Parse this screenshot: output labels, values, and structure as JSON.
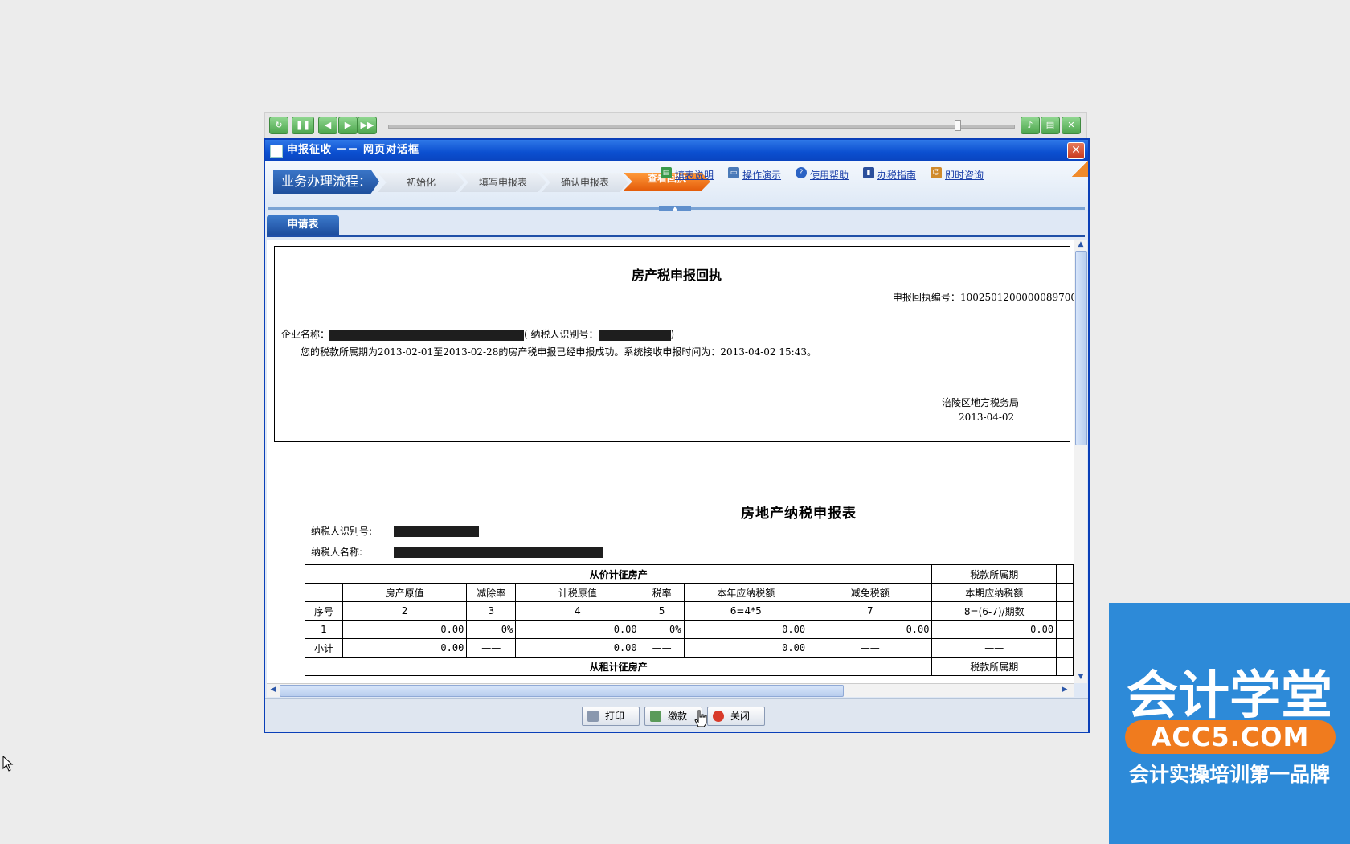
{
  "dialog": {
    "title": "申报征收 －－ 网页对话框",
    "close_glyph": "✕"
  },
  "flow": {
    "label": "业务办理流程：",
    "steps": [
      "初始化",
      "填写申报表",
      "确认申报表",
      "查看回执"
    ]
  },
  "help_links": [
    "填表说明",
    "操作演示",
    "使用帮助",
    "办税指南",
    "即时咨询"
  ],
  "tabs": [
    "申请表"
  ],
  "receipt": {
    "title": "房产税申报回执",
    "number_label": "申报回执编号：",
    "number": "1002501200000089700",
    "company_label": "企业名称：",
    "taxpayer_id_label": "( 纳税人识别号：",
    "close_paren": ")",
    "message": "您的税款所属期为2013-02-01至2013-02-28的房产税申报已经申报成功。系统接收申报时间为：2013-04-02 15:43。",
    "bureau": "涪陵区地方税务局",
    "date": "2013-04-02"
  },
  "form": {
    "title": "房地产纳税申报表",
    "taxpayer_id_label": "纳税人识别号:",
    "taxpayer_name_label": "纳税人名称:",
    "section1": "从价计征房产",
    "section2": "从租计征房产",
    "period_header": "税款所属期",
    "columns": [
      "房产原值",
      "减除率",
      "计税原值",
      "税率",
      "本年应纳税额",
      "减免税额",
      "本期应纳税额"
    ],
    "seq_label": "序号",
    "formula_row": [
      "2",
      "3",
      "4",
      "5",
      "6=4*5",
      "7",
      "8=(6-7)/期数"
    ],
    "row1": [
      "1",
      "0.00",
      "0%",
      "0.00",
      "0%",
      "0.00",
      "0.00",
      "0.00"
    ],
    "subtotal": [
      "小计",
      "0.00",
      "——",
      "0.00",
      "——",
      "0.00",
      "——",
      "——"
    ]
  },
  "buttons": {
    "print": "打印",
    "pay": "缴款",
    "close": "关闭"
  },
  "watermark": {
    "title": "会计学堂",
    "site": "ACC5.COM",
    "slogan": "会计实操培训第一品牌"
  },
  "player": {
    "buttons": [
      "replay-icon",
      "pause-icon",
      "prev-icon",
      "next-icon",
      "fast-forward-icon",
      "volume-icon",
      "save-icon",
      "close-icon"
    ]
  }
}
